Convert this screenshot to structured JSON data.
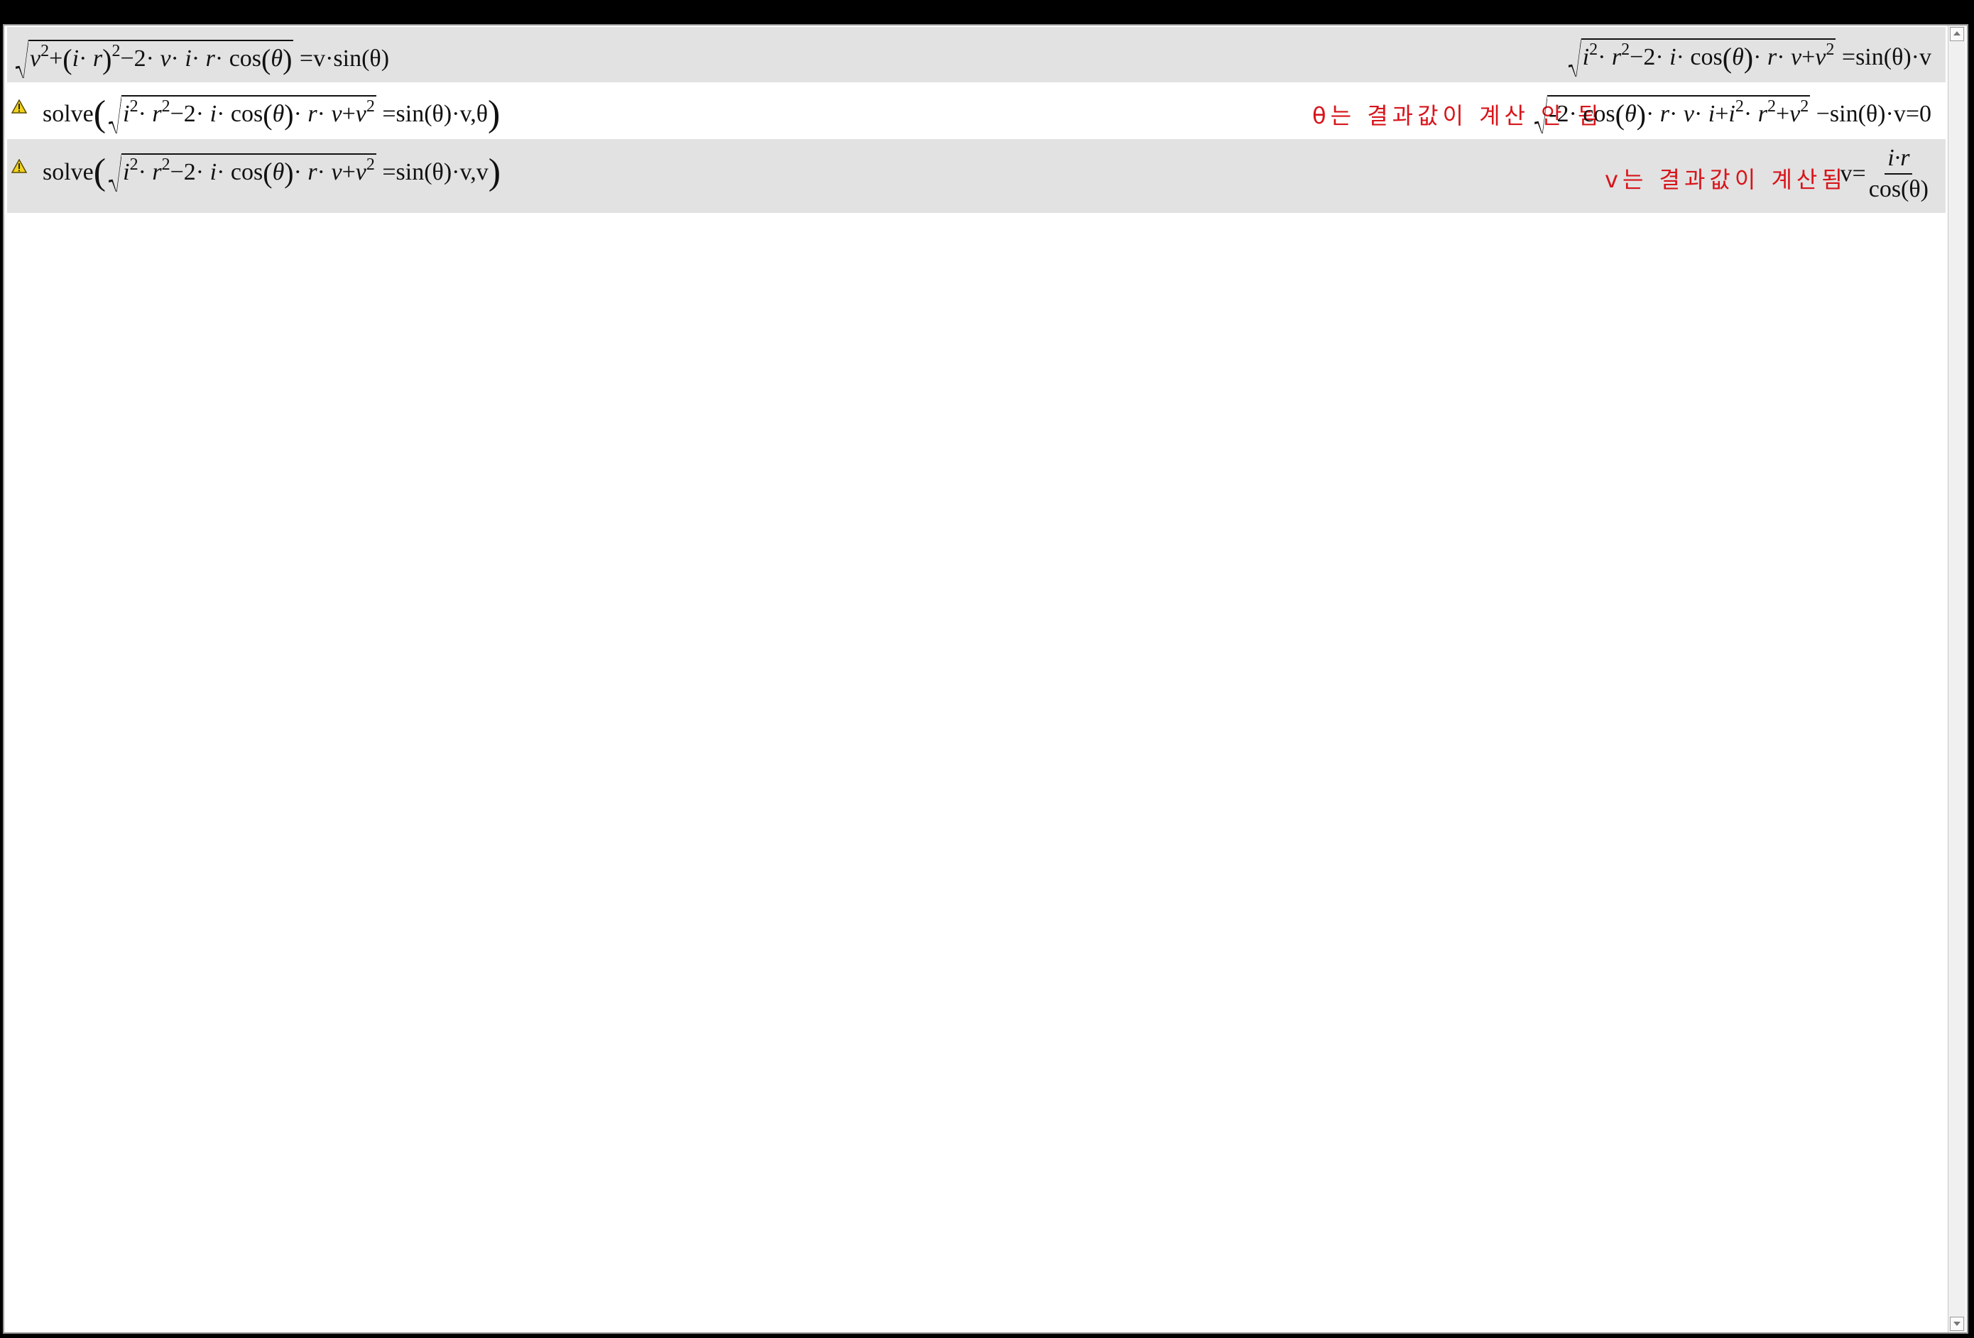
{
  "rows": [
    {
      "input": {
        "sqrt_content": "v2+(i·r)2−2·v·i·r·cos(θ)",
        "rhs": "=v·sin(θ)"
      },
      "output": {
        "sqrt_content": "i2·r2−2·i·cos(θ)·r·v+v2",
        "rhs": "=sin(θ)·v"
      }
    },
    {
      "warning": true,
      "input": {
        "func": "solve",
        "sqrt_content": "i2·r2−2·i·cos(θ)·r·v+v2",
        "rhs": "=sin(θ)·v,θ"
      },
      "note": "θ는 결과값이 계산 안 됨",
      "output": {
        "sqrt_content": "-2·cos(θ)·r·v·i+i2·r2+v2",
        "rhs": "−sin(θ)·v=0"
      }
    },
    {
      "warning": true,
      "input": {
        "func": "solve",
        "sqrt_content": "i2·r2−2·i·cos(θ)·r·v+v2",
        "rhs": "=sin(θ)·v,v"
      },
      "note": "v는 결과값이 계산됨",
      "output": {
        "lhs": "v=",
        "numerator": "i·r",
        "denominator": "cos(θ)"
      }
    }
  ],
  "colors": {
    "note": "#d8141a",
    "shade": "#e2e2e2",
    "warning_fill": "#f2d21b"
  },
  "icons": [
    "warning-icon"
  ]
}
